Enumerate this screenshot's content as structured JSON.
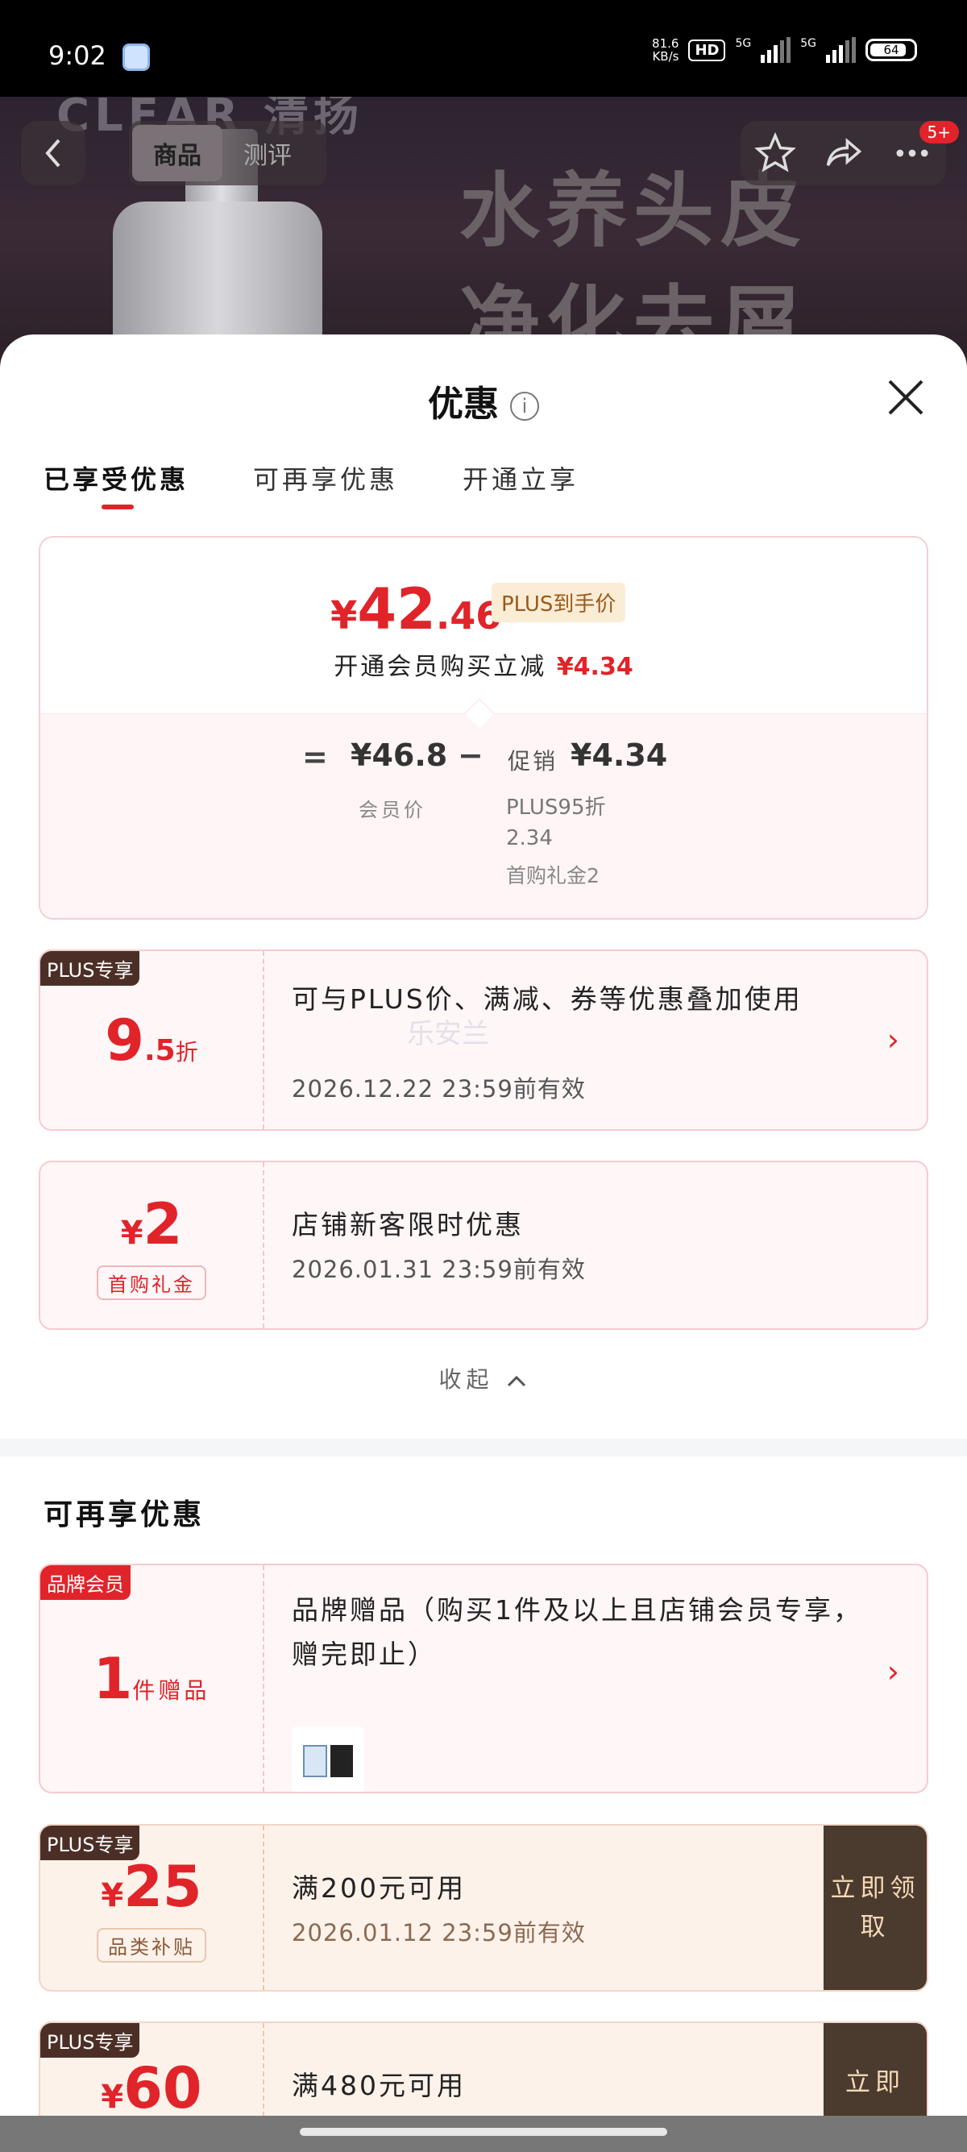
{
  "status_bar": {
    "time": "9:02",
    "speed_value": "81.6",
    "speed_unit": "KB/s",
    "hd_label": "HD",
    "signal_1_label": "5G",
    "signal_2_label": "5G",
    "battery": "64"
  },
  "product": {
    "brand": "CLEAR 清扬",
    "headline_1": "水养头皮",
    "headline_2": "净化去屑"
  },
  "top_nav": {
    "tabs": [
      "商品",
      "测评"
    ],
    "badge": "5+"
  },
  "sheet": {
    "title": "优惠",
    "tabs": [
      "已享受优惠",
      "可再享优惠",
      "开通立享"
    ],
    "summary": {
      "currency": "¥",
      "price_int": "42",
      "price_dec": ".46",
      "plus_tag": "PLUS到手价",
      "save_text": "开通会员购买立减",
      "save_amount": "¥4.34",
      "equals": "=",
      "member_price": "¥46.8",
      "minus": "−",
      "promo_label": "促销",
      "promo_amount": "¥4.34",
      "member_label": "会员价",
      "plus95_line1": "PLUS95折",
      "plus95_line2": "2.34",
      "first_gift": "首购礼金2"
    },
    "coupons": [
      {
        "tag": "PLUS专享",
        "value_int": "9",
        "value_dec": ".5",
        "value_unit": "折",
        "desc": "可与PLUS价、满减、券等优惠叠加使用",
        "valid": "2026.12.22  23:59前有效"
      },
      {
        "currency": "¥",
        "value": "2",
        "sub_label": "首购礼金",
        "desc": "店铺新客限时优惠",
        "valid": "2026.01.31  23:59前有效"
      }
    ],
    "collapse_label": "收起",
    "more_section_title": "可再享优惠",
    "more_coupons": [
      {
        "tag": "品牌会员",
        "value": "1",
        "value_unit": "件赠品",
        "desc": "品牌赠品（购买1件及以上且店铺会员专享，赠完即止）"
      },
      {
        "tag": "PLUS专享",
        "currency": "¥",
        "value": "25",
        "sub_label": "品类补贴",
        "desc": "满200元可用",
        "valid": "2026.01.12  23:59前有效",
        "claim": "立即领取"
      },
      {
        "tag": "PLUS专享",
        "currency": "¥",
        "value": "60",
        "desc": "满480元可用",
        "claim": "立即"
      }
    ],
    "watermark": "乐安兰"
  },
  "colors": {
    "accent_red": "#e0242a",
    "plus_dark": "#4b3a2e",
    "gold_bg": "#fdf2ea"
  }
}
